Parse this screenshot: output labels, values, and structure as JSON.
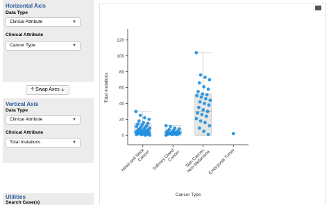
{
  "horizontal_panel": {
    "title": "Horizontal Axis",
    "data_type_label": "Data Type",
    "data_type_value": "Clinical Attribute",
    "attribute_label": "Clinical Attribute",
    "attribute_value": "Cancer Type"
  },
  "swap_label": "Swap Axes",
  "vertical_panel": {
    "title": "Vertical Axis",
    "data_type_label": "Data Type",
    "data_type_value": "Clinical Attribute",
    "attribute_label": "Clinical Attribute",
    "attribute_value": "Total mutations"
  },
  "utilities": {
    "title": "Utilities",
    "search_label": "Search Case(s)"
  },
  "icons": [
    "chevron-down-icon",
    "arrow-up-icon",
    "arrow-down-icon",
    "download-icon"
  ],
  "colors": {
    "point": "#1e8fe0",
    "title": "#2a5a98",
    "box": "#e6e6e6"
  },
  "chart_data": {
    "type": "box-scatter",
    "xlabel": "Cancer Type",
    "ylabel": "Total mutations",
    "ylim": [
      -12,
      132
    ],
    "yticks": [
      0,
      20,
      40,
      60,
      80,
      100,
      120
    ],
    "categories": [
      "Head and Neck Cancer",
      "Salivary Gland Cancer",
      "Skin Cancer, Non-Melanoma",
      "Embryonal Tumor"
    ],
    "category_labels": [
      [
        "Head and Neck",
        "Cancer"
      ],
      [
        "Salivary Gland",
        "Cancer"
      ],
      [
        "Skin Cancer,",
        "Non-Melanoma"
      ],
      [
        "Embryonal Tumor"
      ]
    ],
    "series": [
      {
        "values": [
          30,
          25,
          22,
          20,
          18,
          16,
          15,
          14,
          13,
          12,
          11,
          10,
          10,
          9,
          8,
          8,
          7,
          7,
          6,
          6,
          5,
          5,
          5,
          4,
          4,
          3,
          3,
          3,
          2,
          2,
          2,
          1,
          1,
          1,
          1,
          0,
          0
        ]
      },
      {
        "values": [
          12,
          11,
          9,
          8,
          7,
          6,
          5,
          5,
          4,
          4,
          4,
          3,
          3,
          3,
          2,
          2,
          2,
          2,
          1,
          1,
          1,
          1,
          1,
          0
        ]
      },
      {
        "values": [
          104,
          76,
          73,
          70,
          66,
          61,
          58,
          55,
          52,
          51,
          50,
          48,
          46,
          44,
          42,
          40,
          38,
          35,
          32,
          30,
          28,
          26,
          24,
          21,
          18,
          16,
          12,
          9,
          5,
          1
        ]
      },
      {
        "values": [
          2
        ]
      }
    ],
    "boxes": [
      {
        "whisker_low": 0,
        "q1": 2,
        "median": 5,
        "q3": 15,
        "whisker_high": 30
      },
      {
        "whisker_low": 0,
        "q1": 1,
        "median": 3,
        "q3": 8,
        "whisker_high": 12
      },
      {
        "whisker_low": 0,
        "q1": 1,
        "median": 30,
        "q3": 52,
        "whisker_high": 104
      },
      null
    ]
  }
}
